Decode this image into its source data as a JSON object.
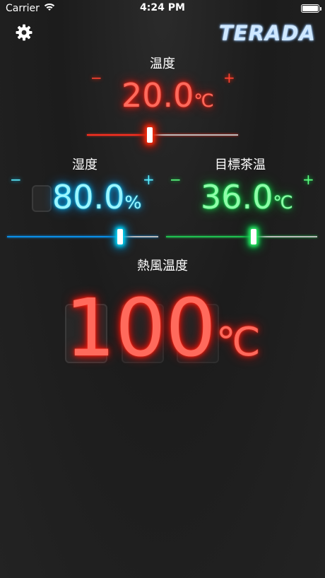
{
  "status_bar": {
    "carrier": "Carrier",
    "time": "4:24 PM"
  },
  "header": {
    "logo_text": "TERADA",
    "settings_icon": "gear-icon"
  },
  "temperature": {
    "label": "温度",
    "value": "20.0",
    "unit": "℃",
    "minus": "−",
    "plus": "+",
    "slider_fraction": 0.4
  },
  "humidity": {
    "label": "湿度",
    "value": "80.0",
    "unit": "%",
    "minus": "−",
    "plus": "+",
    "slider_fraction": 0.76
  },
  "target_tea_temp": {
    "label": "目標茶温",
    "value": "36.0",
    "unit": "℃",
    "minus": "−",
    "plus": "+",
    "slider_fraction": 0.58
  },
  "hot_air_temp": {
    "label": "熱風温度",
    "value": "100",
    "unit": "℃"
  },
  "colors": {
    "red": "#ff4433",
    "cyan": "#00c0ff",
    "green": "#16e050"
  }
}
